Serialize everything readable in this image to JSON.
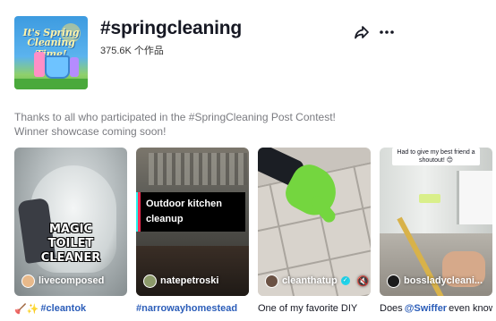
{
  "header": {
    "cover_line1": "It's Spring",
    "cover_line2": "Cleaning Time!",
    "title": "#springcleaning",
    "count": "375.6K 个作品",
    "share_icon": "share-arrow-icon",
    "more_icon": "more-horizontal-icon"
  },
  "description": {
    "line1": "Thanks to all who participated in the #SpringCleaning Post Contest!",
    "line2": "Winner showcase coming soon!"
  },
  "videos": [
    {
      "author": "livecomposed",
      "overlay": [
        "MAGIC",
        "TOILET",
        "CLEANER"
      ],
      "caption_prefix": "🪠✨",
      "caption_tag": "#cleantok"
    },
    {
      "author": "natepetroski",
      "overlay": [
        "Outdoor kitchen",
        "cleanup"
      ],
      "caption_tag": "#narrowayhomestead"
    },
    {
      "author": "cleanthatup",
      "verified": true,
      "caption_text": "One of my favorite DIY"
    },
    {
      "author": "bossladycleani...",
      "overlay_note": "Had to give my best friend a shoutout! 😊",
      "caption_pre": "Does ",
      "caption_tag": "@Swiffer",
      "caption_post": " even know"
    }
  ],
  "colors": {
    "text": "#161823",
    "muted": "#7a7b80",
    "tag": "#2b5db9",
    "accent_pink": "#fe2c55",
    "accent_cyan": "#25f4ee"
  }
}
